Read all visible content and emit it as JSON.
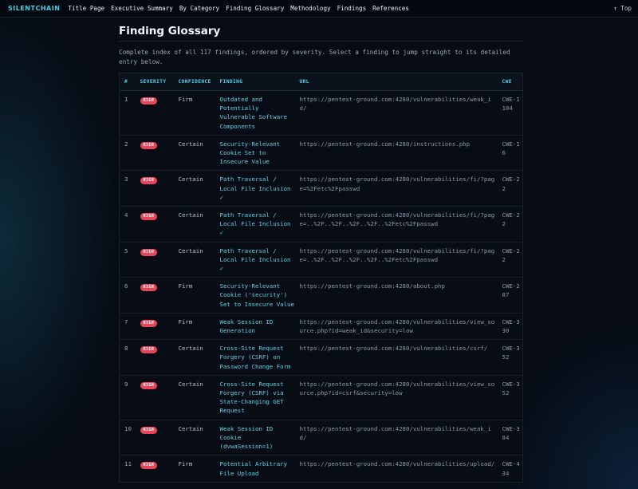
{
  "nav": {
    "brand": "SILENTCHAIN",
    "links": [
      "Title Page",
      "Executive Summary",
      "By Category",
      "Finding Glossary",
      "Methodology",
      "Findings",
      "References"
    ],
    "top_link": "↑ Top"
  },
  "page": {
    "title": "Finding Glossary",
    "intro": "Complete index of all 117 findings, ordered by severity. Select a finding to jump straight to its detailed entry below."
  },
  "table": {
    "headers": [
      "#",
      "SEVERITY",
      "CONFIDENCE",
      "FINDING",
      "URL",
      "CWE"
    ],
    "rows": [
      {
        "num": "1",
        "severity": "HIGH",
        "confidence": "Firm",
        "finding": "Outdated and Potentially Vulnerable Software Components",
        "verified": "",
        "url": "https://pentest-ground.com:4280/vulnerabilities/weak_id/",
        "cwe": "CWE-1104"
      },
      {
        "num": "2",
        "severity": "HIGH",
        "confidence": "Certain",
        "finding": "Security-Relevant Cookie Set to Insecure Value",
        "verified": "",
        "url": "https://pentest-ground.com:4280/instructions.php",
        "cwe": "CWE-16"
      },
      {
        "num": "3",
        "severity": "HIGH",
        "confidence": "Certain",
        "finding": "Path Traversal / Local File Inclusion",
        "verified": "✓",
        "url": "https://pentest-ground.com:4280/vulnerabilities/fi/?page=%2Fetc%2Fpasswd",
        "cwe": "CWE-22"
      },
      {
        "num": "4",
        "severity": "HIGH",
        "confidence": "Certain",
        "finding": "Path Traversal / Local File Inclusion",
        "verified": "✓",
        "url": "https://pentest-ground.com:4280/vulnerabilities/fi/?page=..%2F..%2F..%2F..%2F..%2Fetc%2Fpasswd",
        "cwe": "CWE-22"
      },
      {
        "num": "5",
        "severity": "HIGH",
        "confidence": "Certain",
        "finding": "Path Traversal / Local File Inclusion",
        "verified": "✓",
        "url": "https://pentest-ground.com:4280/vulnerabilities/fi/?page=..%2F..%2F..%2F..%2F..%2Fetc%2Fpasswd",
        "cwe": "CWE-22"
      },
      {
        "num": "6",
        "severity": "HIGH",
        "confidence": "Firm",
        "finding": "Security-Relevant Cookie ('security') Set to Insecure Value",
        "verified": "",
        "url": "https://pentest-ground.com:4280/about.php",
        "cwe": "CWE-287"
      },
      {
        "num": "7",
        "severity": "HIGH",
        "confidence": "Firm",
        "finding": "Weak Session ID Generation",
        "verified": "",
        "url": "https://pentest-ground.com:4280/vulnerabilities/view_source.php?id=weak_id&security=low",
        "cwe": "CWE-330"
      },
      {
        "num": "8",
        "severity": "HIGH",
        "confidence": "Certain",
        "finding": "Cross-Site Request Forgery (CSRF) on Password Change Form",
        "verified": "",
        "url": "https://pentest-ground.com:4280/vulnerabilities/csrf/",
        "cwe": "CWE-352"
      },
      {
        "num": "9",
        "severity": "HIGH",
        "confidence": "Certain",
        "finding": "Cross-Site Request Forgery (CSRF) via State-Changing GET Request",
        "verified": "",
        "url": "https://pentest-ground.com:4280/vulnerabilities/view_source.php?id=csrf&security=low",
        "cwe": "CWE-352"
      },
      {
        "num": "10",
        "severity": "HIGH",
        "confidence": "Certain",
        "finding": "Weak Session ID Cookie (dvwaSession=1)",
        "verified": "",
        "url": "https://pentest-ground.com:4280/vulnerabilities/weak_id/",
        "cwe": "CWE-384"
      },
      {
        "num": "11",
        "severity": "HIGH",
        "confidence": "Firm",
        "finding": "Potential Arbitrary File Upload",
        "verified": "",
        "url": "https://pentest-ground.com:4280/vulnerabilities/upload/",
        "cwe": "CWE-434"
      }
    ]
  },
  "colors": {
    "accent": "#5fd3e8",
    "brand": "#3fd0e6",
    "high_badge": "#e8455a",
    "verified_check": "#3ee07a",
    "background": "#060b14"
  }
}
